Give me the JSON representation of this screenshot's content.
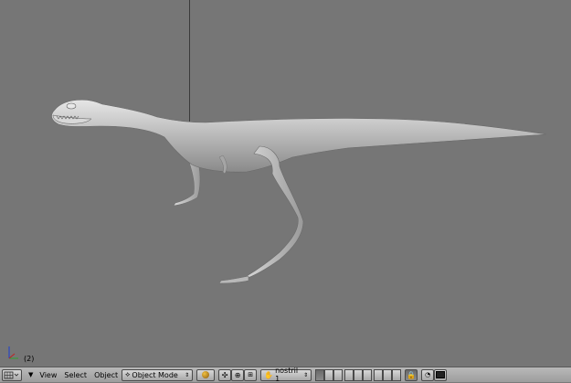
{
  "header": {
    "editor_type_icon": "view3d-grid-icon",
    "menus": [
      "View",
      "Select",
      "Object"
    ],
    "mode": {
      "label": "Object Mode",
      "icon": "object-mode-icon"
    },
    "shading_icon": "solid-shading-icon",
    "pivot_icon": "pivot-icon",
    "manipulator_icon": "manipulator-icon",
    "manipulator_alt_icon": "rotate-manipulator-icon",
    "bone_icon": "hand-icon",
    "active_layer_label": "nostril 1",
    "lock_icon": "lock-icon",
    "render_preview_icon": "render-icon",
    "render_image_icon": "camera-icon"
  },
  "viewport": {
    "frame_label": "(2)",
    "model": "dinosaur-mesh"
  },
  "colors": {
    "viewport_bg": "#767676",
    "header_bg": "#a8a8a8",
    "mesh": "#c4c4c4"
  }
}
